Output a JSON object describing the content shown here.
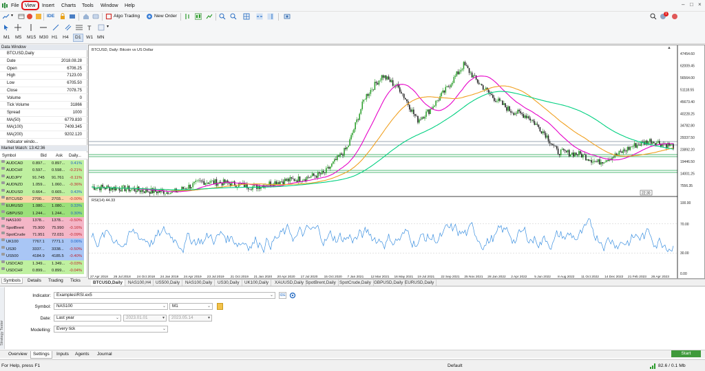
{
  "menu": {
    "items": [
      "File",
      "View",
      "Insert",
      "Charts",
      "Tools",
      "Window",
      "Help"
    ]
  },
  "toolbar": {
    "ide_label": "IDE",
    "algo_label": "Algo Trading",
    "new_order_label": "New Order",
    "notification_count": "1",
    "timeframes": [
      "M1",
      "M5",
      "M15",
      "M30",
      "H1",
      "H4",
      "D1",
      "W1",
      "MN"
    ],
    "active_timeframe": "D1"
  },
  "data_window": {
    "title": "Data Window",
    "symbol": "BTCUSD,Daily",
    "rows": [
      {
        "key": "Date",
        "value": "2018.08.28"
      },
      {
        "key": "Open",
        "value": "6706.25"
      },
      {
        "key": "High",
        "value": "7123.00"
      },
      {
        "key": "Low",
        "value": "6705.50"
      },
      {
        "key": "Close",
        "value": "7078.75"
      },
      {
        "key": "Volume",
        "value": "0"
      },
      {
        "key": "Tick Volume",
        "value": "31866"
      },
      {
        "key": "Spread",
        "value": "1000"
      },
      {
        "key": "MA(50)",
        "value": "6779.830"
      },
      {
        "key": "MA(100)",
        "value": "7409.345"
      },
      {
        "key": "MA(200)",
        "value": "9202.120"
      },
      {
        "key": "Indicator windo...",
        "value": ""
      }
    ]
  },
  "market_watch": {
    "title": "Market Watch: 13:42:36",
    "headers": [
      "Symbol",
      "Bid",
      "Ask",
      "Daily..."
    ],
    "rows": [
      {
        "symbol": "AUDCAD",
        "bid": "0.897...",
        "ask": "0.897...",
        "change": "0.41%",
        "color": "#bff0a0"
      },
      {
        "symbol": "AUDCHF",
        "bid": "0.597...",
        "ask": "0.598...",
        "change": "-0.21%",
        "color": "#bff0a0"
      },
      {
        "symbol": "AUDJPY",
        "bid": "91.745",
        "ask": "91.761",
        "change": "-0.11%",
        "color": "#bff0a0"
      },
      {
        "symbol": "AUDNZD",
        "bid": "1.059...",
        "ask": "1.060...",
        "change": "-0.36%",
        "color": "#bff0a0"
      },
      {
        "symbol": "AUDUSD",
        "bid": "0.664...",
        "ask": "0.665...",
        "change": "0.43%",
        "color": "#bff0a0"
      },
      {
        "symbol": "BTCUSD",
        "bid": "2700...",
        "ask": "2703...",
        "change": "-0.00%",
        "color": "#f9d6a8"
      },
      {
        "symbol": "EURUSD",
        "bid": "1.080...",
        "ask": "1.080...",
        "change": "0.33%",
        "color": "#9be07a"
      },
      {
        "symbol": "GBPUSD",
        "bid": "1.244...",
        "ask": "1.244...",
        "change": "0.30%",
        "color": "#9be07a"
      },
      {
        "symbol": "NAS100",
        "bid": "1378...",
        "ask": "1378...",
        "change": "-0.50%",
        "color": "#f4b6c7"
      },
      {
        "symbol": "SpotBrent",
        "bid": "75.900",
        "ask": "75.990",
        "change": "-0.16%",
        "color": "#f4b6c7"
      },
      {
        "symbol": "SpotCrude",
        "bid": "71.951",
        "ask": "72.031",
        "change": "-0.09%",
        "color": "#f4b6c7"
      },
      {
        "symbol": "UK100",
        "bid": "7767.1",
        "ask": "7771.1",
        "change": "0.06%",
        "color": "#a9c6f5"
      },
      {
        "symbol": "US30",
        "bid": "3337...",
        "ask": "3338...",
        "change": "-0.50%",
        "color": "#a9c6f5"
      },
      {
        "symbol": "US500",
        "bid": "4184.9",
        "ask": "4185.5",
        "change": "-0.40%",
        "color": "#a9c6f5"
      },
      {
        "symbol": "USDCAD",
        "bid": "1.349...",
        "ask": "1.349...",
        "change": "-0.03%",
        "color": "#bff0a0"
      },
      {
        "symbol": "USDCHF",
        "bid": "0.899...",
        "ask": "0.899...",
        "change": "-0.04%",
        "color": "#bff0a0"
      }
    ]
  },
  "left_tabs": [
    "Symbols",
    "Details",
    "Trading",
    "Ticks"
  ],
  "chart": {
    "title": "BTCUSD, Daily: Bitcoin vs US Dollar",
    "price_labels": [
      "47454.60",
      "62009.45",
      "56564.00",
      "51118.55",
      "45673.40",
      "40228.25",
      "34782.80",
      "29337.50",
      "23892.20",
      "19446.50",
      "14001.25",
      "7556.35"
    ],
    "x_labels": [
      "27 Apr 2018",
      "26 Jul 2018",
      "24 Oct 2018",
      "24 Jan 2019",
      "24 Apr 2019",
      "23 Jul 2019",
      "21 Oct 2019",
      "21 Jan 2020",
      "20 Apr 2020",
      "17 Jul 2020",
      "15 Oct 2020",
      "7 Jan 2021",
      "12 Mar 2021",
      "16 May 2021",
      "19 Jul 2021",
      "22 Sep 2021",
      "25 Nov 2021",
      "28 Jan 2022",
      "2 Apr 2022",
      "5 Jun 2022",
      "8 Aug 2022",
      "11 Oct 2022",
      "14 Dec 2022",
      "21 Feb 2023",
      "26 Apr 2023"
    ],
    "rsi_label": "RSI(14) 44.33",
    "rsi_levels": [
      "100.00",
      "70.00",
      "30.00",
      "0.00"
    ],
    "time_marker": "22:30",
    "colors": {
      "ma50": "#e600c8",
      "ma100": "#f0a020",
      "ma200": "#00d080",
      "rsi": "#3a8fe0",
      "candle_up": "#2ea02e",
      "candle_dn": "#222222"
    }
  },
  "chart_tabs": [
    "BTCUSD,Daily",
    "NAS100,H4",
    "US500,Daily",
    "NAS100,Daily",
    "US30,Daily",
    "UK100,Daily",
    "XAUUSD,Daily",
    "SpotBrent,Daily",
    "SpotCrude,Daily",
    "GBPUSD,Daily",
    "EURUSD,Daily"
  ],
  "tester": {
    "indicator_label": "Indicator:",
    "indicator_value": "Examples\\RSI.ex5",
    "symbol_label": "Symbol:",
    "symbol_value": "NAS100",
    "period_value": "M1",
    "date_label": "Date:",
    "date_value": "Last year",
    "date_from": "2023.01.01",
    "date_to": "2023.05.14",
    "modelling_label": "Modelling:",
    "modelling_value": "Every tick",
    "side_label": "Strategy Tester",
    "tabs": [
      "Overview",
      "Settings",
      "Inputs",
      "Agents",
      "Journal"
    ],
    "active_tab": "Settings",
    "start_label": "Start"
  },
  "status": {
    "help_text": "For Help, press F1",
    "profile": "Default",
    "connection": "82.6 / 0.1 Mb"
  }
}
